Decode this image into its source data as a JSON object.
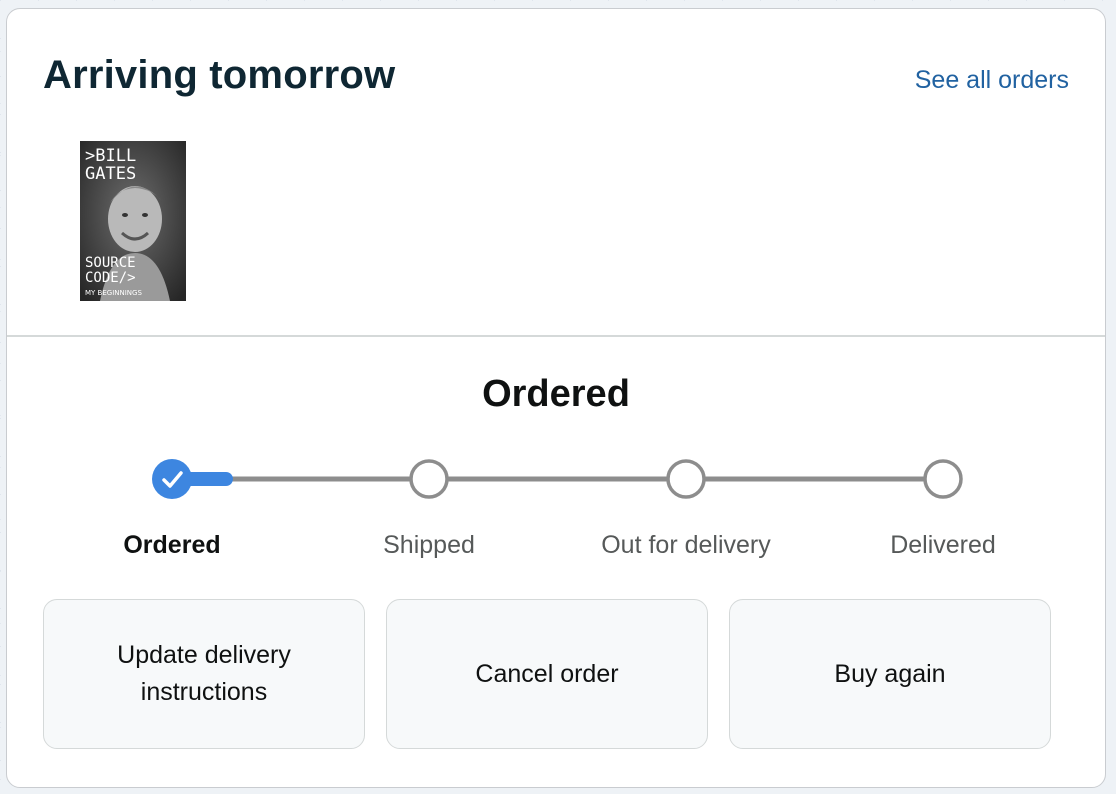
{
  "card": {
    "title": "Arriving tomorrow",
    "see_all_link": "See all orders"
  },
  "product": {
    "cover_lines": [
      ">BILL",
      "GATES",
      "SOURCE",
      "CODE/>",
      "MY BEGINNINGS"
    ],
    "cover_colors": {
      "background": "#3a3a3a",
      "text": "#ffffff"
    }
  },
  "tracking": {
    "current_status": "Ordered",
    "steps": [
      {
        "label": "Ordered",
        "state": "complete"
      },
      {
        "label": "Shipped",
        "state": "pending"
      },
      {
        "label": "Out for delivery",
        "state": "pending"
      },
      {
        "label": "Delivered",
        "state": "pending"
      }
    ],
    "progress_fraction": 0.07,
    "colors": {
      "complete": "#3d86e0",
      "track": "#8d8d8d",
      "pending_ring": "#8d8d8d"
    }
  },
  "actions": {
    "update_delivery": "Update delivery instructions",
    "cancel_order": "Cancel order",
    "buy_again": "Buy again"
  },
  "icons": {
    "step_complete": "checkmark-icon"
  }
}
